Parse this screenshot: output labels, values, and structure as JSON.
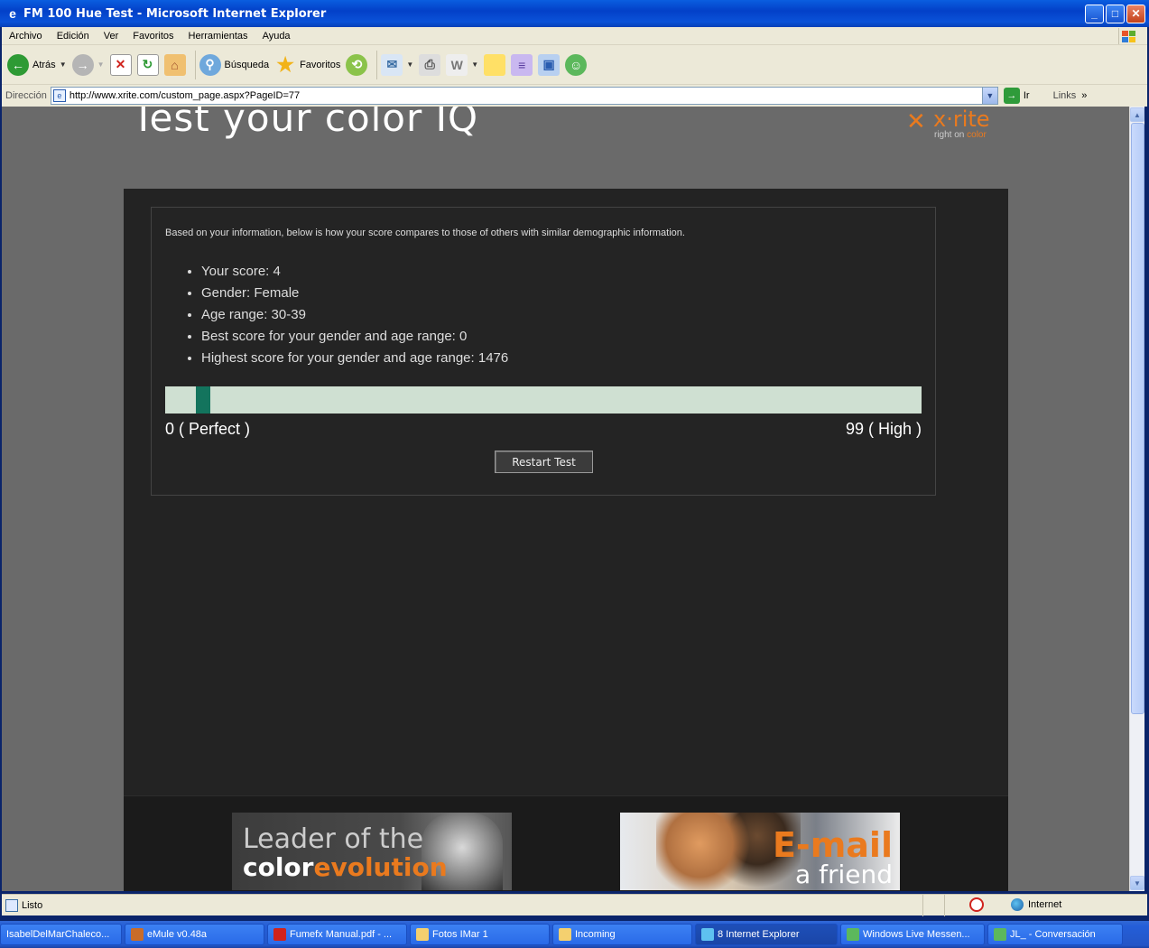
{
  "window": {
    "title": "FM 100 Hue Test - Microsoft Internet Explorer"
  },
  "menu": [
    "Archivo",
    "Edición",
    "Ver",
    "Favoritos",
    "Herramientas",
    "Ayuda"
  ],
  "toolbar": {
    "back_label": "Atrás",
    "search_label": "Búsqueda",
    "favorites_label": "Favoritos"
  },
  "address": {
    "label": "Dirección",
    "url": "http://www.xrite.com/custom_page.aspx?PageID=77",
    "go_label": "Ir",
    "links_label": "Links"
  },
  "page": {
    "title": "Test your color IQ",
    "logo": {
      "word": "x·rite",
      "tag_prefix": "right on ",
      "tag_accent": "color"
    },
    "intro": "Based on your information, below is how your score compares to those of others with similar demographic information.",
    "stats": [
      "Your score: 4",
      "Gender: Female",
      "Age range: 30-39",
      "Best score for your gender and age range: 0",
      "Highest score for your gender and age range: 1476"
    ],
    "score_scale": {
      "min_label": "0 ( Perfect )",
      "max_label": "99 ( High )",
      "marker_fraction": 0.04
    },
    "restart_label": "Restart Test",
    "banner_left": {
      "line1": "Leader of the",
      "line2a": "color",
      "line2b": "evolution"
    },
    "banner_right": {
      "line1": "E-mail",
      "line2": "a friend"
    }
  },
  "status": {
    "text": "Listo",
    "zone": "Internet"
  },
  "taskbar": [
    "IsabelDelMarChaleco...",
    "eMule v0.48a",
    "Fumefx Manual.pdf - ...",
    "Fotos IMar 1",
    "Incoming",
    "8 Internet Explorer",
    "Windows Live Messen...",
    "JL_ - Conversación"
  ],
  "colors": {
    "accent": "#ea7a1e",
    "bar_bg": "#cfe0d2",
    "marker": "#13745d",
    "panel_bg": "#242424"
  }
}
